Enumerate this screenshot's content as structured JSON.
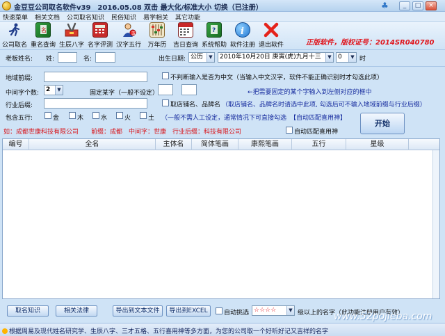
{
  "window": {
    "title": "金豆豆公司取名软件v39　2016.05.08  双击 最大化/标准大小 切换（已注册）",
    "minimize_glyph": "_",
    "maximize_glyph": "□",
    "close_glyph": "×"
  },
  "menu": [
    "快速菜单",
    "相关文档",
    "公司取名知识",
    "民俗知识",
    "易学相关",
    "其它功能"
  ],
  "toolbar": {
    "items": [
      {
        "label": "公司取名",
        "icon": "runner-icon"
      },
      {
        "label": "重名查询",
        "icon": "book-icon"
      },
      {
        "label": "生辰八字",
        "icon": "tools-icon"
      },
      {
        "label": "名字评测",
        "icon": "calculator-icon"
      },
      {
        "label": "汉字五行",
        "icon": "person-icon"
      },
      {
        "label": "万年历",
        "icon": "abacus-icon"
      },
      {
        "label": "吉日查询",
        "icon": "calendar-icon"
      },
      {
        "label": "系统帮助",
        "icon": "help-book-icon"
      },
      {
        "label": "软件注册",
        "icon": "info-icon"
      },
      {
        "label": "退出软件",
        "icon": "exit-icon"
      }
    ],
    "reg_notice": "正版软件，版权证号：2014SR040780"
  },
  "form": {
    "boss_name_label": "老板姓名:",
    "surname_label": "姓:",
    "given_label": "名:",
    "birth_label": "出生日期:",
    "calendar_type": "公历",
    "birth_date": "2010年10月20日 庚寅(虎)九月十三",
    "birth_hour": "0",
    "hour_unit": "时",
    "region_label": "地域前缀:",
    "cn_check_label": "不判断输入是否为中文（当输入中文汉字，软件不能正确识别时才勾选此项）",
    "middle_count_label": "中间字个数:",
    "middle_count": "2",
    "fixed_char_label": "固定某字（一般不设定）",
    "fixed_hint": "←把需要固定的某个字输入到左侧对应的框中",
    "industry_label": "行业后缀:",
    "brand_check_label": "取店铺名、品牌名",
    "brand_hint": "（取店铺名、品牌名时请选中此项, 勾选后可不输入地域前缀与行业后缀）",
    "wuxing_label": "包含五行:",
    "wuxing": [
      "金",
      "木",
      "水",
      "火",
      "土"
    ],
    "wuxing_hint": "（一般不需人工设定，通常情况下可直接勾选",
    "auto_match_hint": "【自动匹配喜用神】",
    "example": "如：成都世康科技有限公司　　前缀：成都　中间字：世康　行业后缀：科技有限公司",
    "auto_match_check": "自动匹配喜用神",
    "start_button": "开始"
  },
  "table": {
    "columns": [
      "编号",
      "全名",
      "主体名",
      "简体笔画",
      "康熙笔画",
      "五行",
      "星级"
    ],
    "rows": []
  },
  "bottom": {
    "btn_knowledge": "取名知识",
    "btn_law": "相关法律",
    "btn_export_txt": "导出到文本文件",
    "btn_export_excel": "导出到EXCEL",
    "auto_pick_label": "自动挑选",
    "stars": "☆☆☆☆",
    "stars_suffix": "级以上的名字（此功能注册用户有效）"
  },
  "status": {
    "text": "根据周易及现代姓名研究学、生辰八字、三才五格、五行喜用神等多方面，为您的公司取一个好听好记又吉祥的名字",
    "watermark": "www.52pojieba.com"
  },
  "colors": {
    "reg_notice": "#e0151c",
    "hint_blue": "#1a2fa0",
    "example_red": "#d8141a"
  }
}
